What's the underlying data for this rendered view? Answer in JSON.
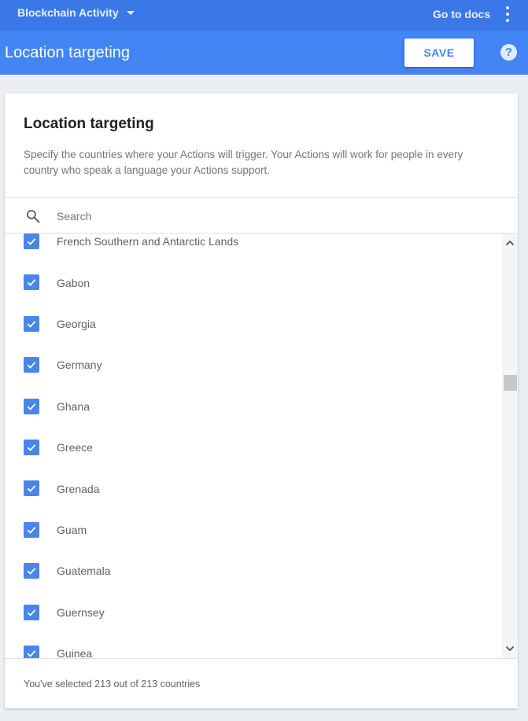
{
  "topbar": {
    "project_name": "Blockchain Activity",
    "docs_link": "Go to docs"
  },
  "header": {
    "title": "Location targeting",
    "save_label": "SAVE",
    "help_glyph": "?"
  },
  "card": {
    "title": "Location targeting",
    "description": "Specify the countries where your Actions will trigger. Your Actions will work for people in every country who speak a language your Actions support."
  },
  "search": {
    "value": "",
    "placeholder": "Search"
  },
  "countries": [
    {
      "name": "French Southern and Antarctic Lands",
      "checked": true
    },
    {
      "name": "Gabon",
      "checked": true
    },
    {
      "name": "Georgia",
      "checked": true
    },
    {
      "name": "Germany",
      "checked": true
    },
    {
      "name": "Ghana",
      "checked": true
    },
    {
      "name": "Greece",
      "checked": true
    },
    {
      "name": "Grenada",
      "checked": true
    },
    {
      "name": "Guam",
      "checked": true
    },
    {
      "name": "Guatemala",
      "checked": true
    },
    {
      "name": "Guernsey",
      "checked": true
    },
    {
      "name": "Guinea",
      "checked": true
    }
  ],
  "footer": {
    "selection_text": "You've selected 213 out of 213 countries"
  },
  "colors": {
    "topbar": "#3b78e7",
    "header": "#4285f4",
    "checkbox": "#4a86e8",
    "background": "#eceff1"
  },
  "icons": {
    "project_menu": "chevron-down-icon",
    "overflow": "more-vert-icon",
    "help": "help-icon",
    "search": "search-icon",
    "checkbox": "check-icon",
    "scroll_up": "chevron-up-icon",
    "scroll_down": "chevron-down-icon"
  }
}
